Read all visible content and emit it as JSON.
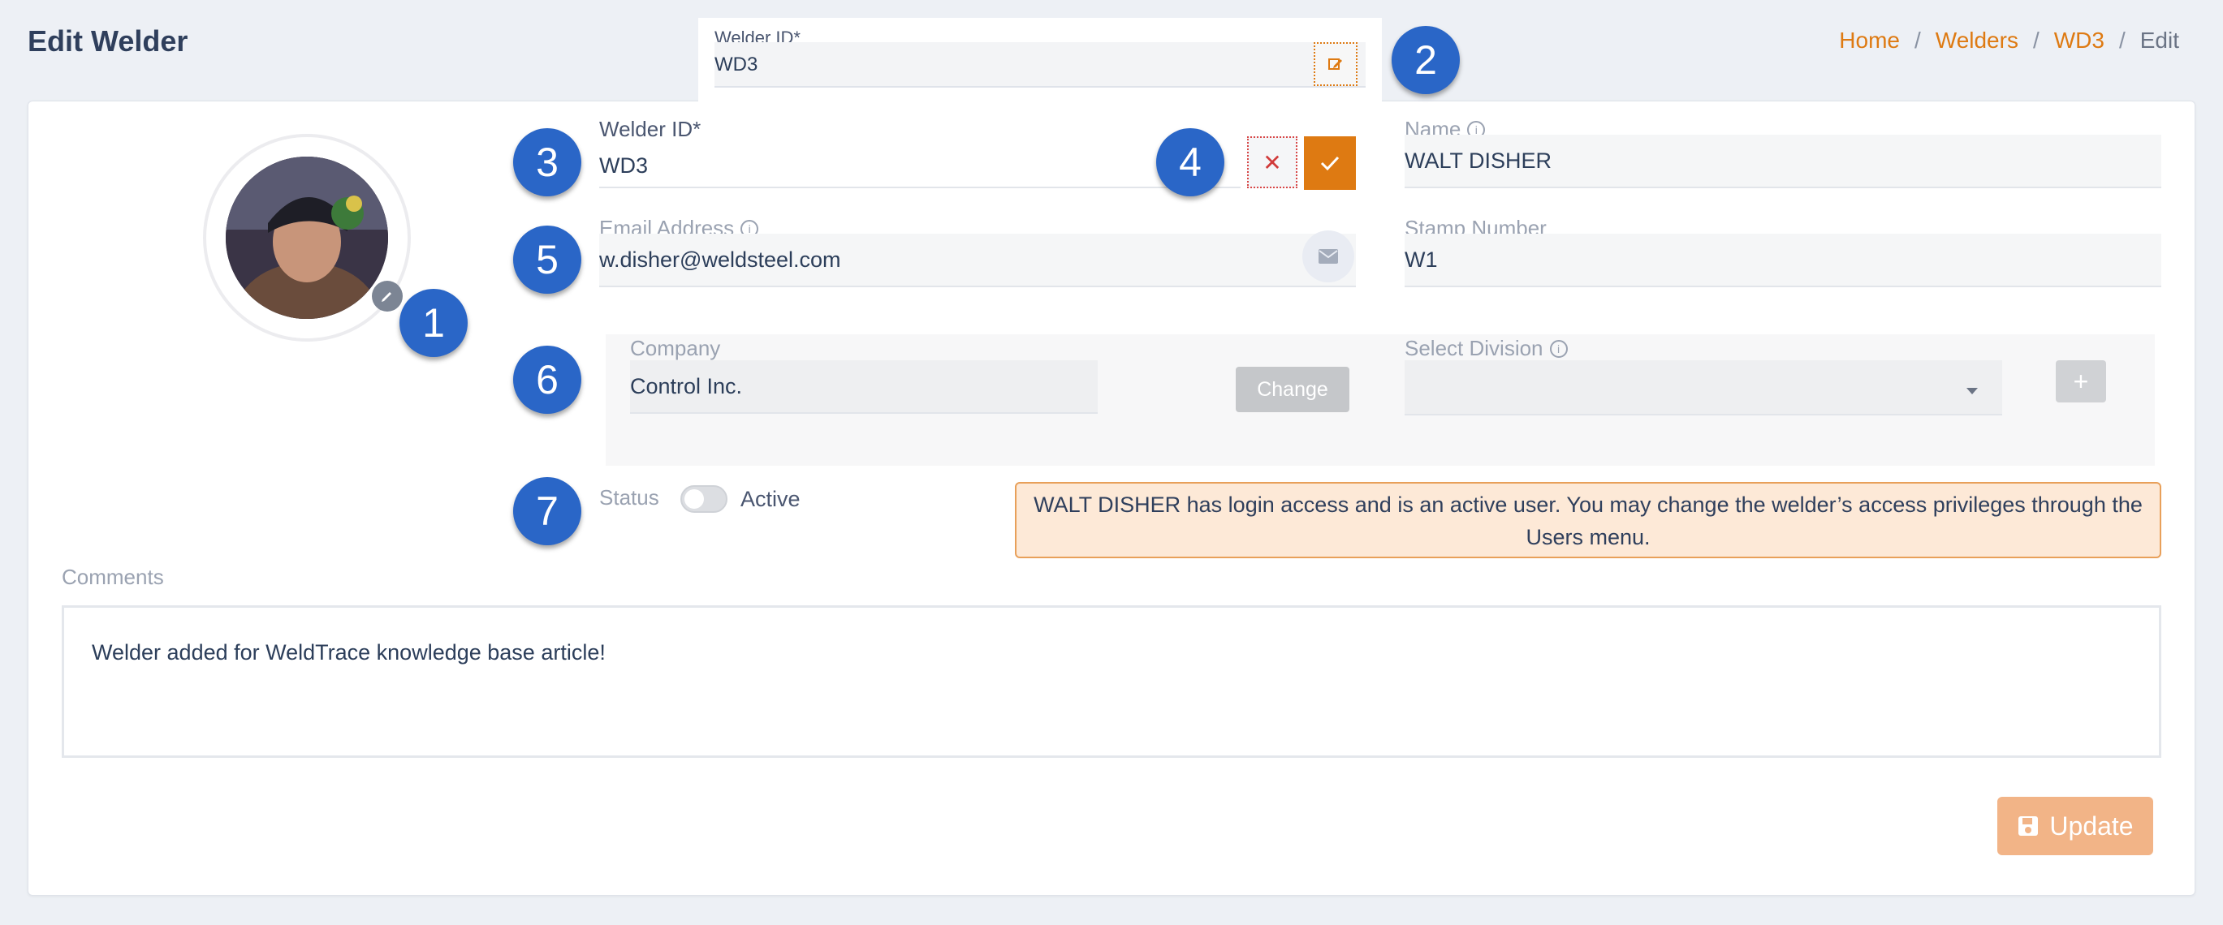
{
  "header": {
    "title": "Edit Welder",
    "breadcrumb": [
      {
        "label": "Home"
      },
      {
        "label": "Welders"
      },
      {
        "label": "WD3"
      },
      {
        "label": "Edit"
      }
    ]
  },
  "popover": {
    "label": "Welder ID*",
    "value": "WD3"
  },
  "markers": [
    "1",
    "2",
    "3",
    "4",
    "5",
    "6",
    "7"
  ],
  "form": {
    "welder_id": {
      "label": "Welder ID*",
      "value": "WD3"
    },
    "name": {
      "label": "Name",
      "value": "WALT DISHER"
    },
    "email": {
      "label": "Email Address",
      "value": "w.disher@weldsteel.com"
    },
    "stamp": {
      "label": "Stamp Number",
      "value": "W1"
    },
    "company": {
      "label": "Company",
      "value": "Control Inc.",
      "change_label": "Change"
    },
    "division": {
      "label": "Select Division",
      "value": "",
      "add_label": "+"
    },
    "status": {
      "label": "Status",
      "value": "Active"
    },
    "notice": "WALT DISHER has login access and is an active user. You may change the welder’s access privileges through the Users menu.",
    "comments": {
      "label": "Comments",
      "value": "Welder added for WeldTrace knowledge base article!"
    },
    "update_label": "Update"
  },
  "colors": {
    "accent": "#de7a12",
    "marker": "#2a66c7",
    "notice_bg": "#fde9d7"
  }
}
